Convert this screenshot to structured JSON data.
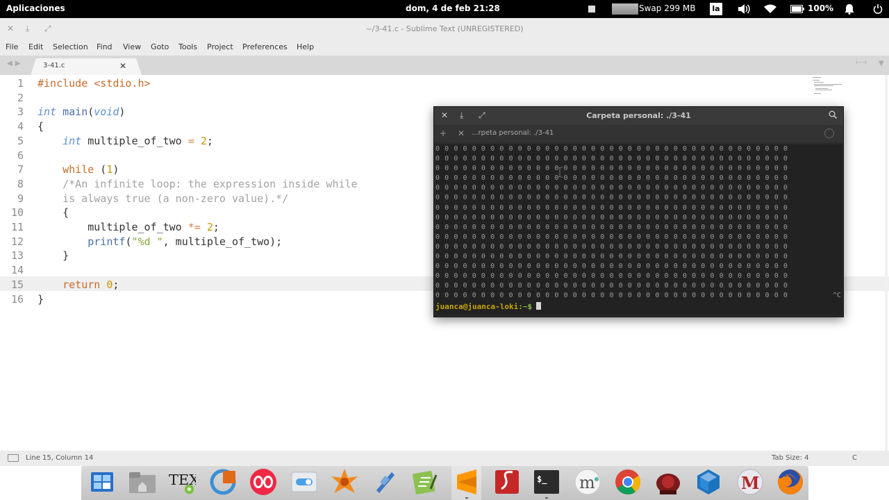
{
  "top_panel": {
    "apps_label": "Aplicaciones",
    "clock": "dom, 4 de feb  21:28",
    "swap": "Swap 299 MB",
    "keyboard_layout": "la",
    "battery": "100%",
    "icons": [
      "screen-icon",
      "volume-icon",
      "wifi-icon",
      "battery-icon",
      "notifications-icon",
      "power-icon"
    ]
  },
  "editor": {
    "window_title": "~/3-41.c - Sublime Text (UNREGISTERED)",
    "menu": [
      "File",
      "Edit",
      "Selection",
      "Find",
      "View",
      "Goto",
      "Tools",
      "Project",
      "Preferences",
      "Help"
    ],
    "tab_label": "3-41.c",
    "current_line": 15,
    "code_lines": [
      [
        [
          "k-pre",
          "#include "
        ],
        [
          "k-pre",
          "<stdio.h>"
        ]
      ],
      [],
      [
        [
          "k-type",
          "int"
        ],
        [
          "k-plain",
          " "
        ],
        [
          "k-fn",
          "main"
        ],
        [
          "k-plain",
          "("
        ],
        [
          "k-type",
          "void"
        ],
        [
          "k-plain",
          ")"
        ]
      ],
      [
        [
          "k-plain",
          "{"
        ]
      ],
      [
        [
          "k-plain",
          "    "
        ],
        [
          "k-type",
          "int"
        ],
        [
          "k-plain",
          " multiple_of_two "
        ],
        [
          "k-op",
          "="
        ],
        [
          "k-plain",
          " "
        ],
        [
          "k-num",
          "2"
        ],
        [
          "k-plain",
          ";"
        ]
      ],
      [],
      [
        [
          "k-plain",
          "    "
        ],
        [
          "k-kw",
          "while"
        ],
        [
          "k-plain",
          " ("
        ],
        [
          "k-num",
          "1"
        ],
        [
          "k-plain",
          ")"
        ]
      ],
      [
        [
          "k-plain",
          "    "
        ],
        [
          "k-cmt",
          "/*An infinite loop: the expression inside while"
        ]
      ],
      [
        [
          "k-plain",
          "    "
        ],
        [
          "k-cmt",
          "is always true (a non-zero value).*/"
        ]
      ],
      [
        [
          "k-plain",
          "    {"
        ]
      ],
      [
        [
          "k-plain",
          "        multiple_of_two "
        ],
        [
          "k-op",
          "*="
        ],
        [
          "k-plain",
          " "
        ],
        [
          "k-num",
          "2"
        ],
        [
          "k-plain",
          ";"
        ]
      ],
      [
        [
          "k-plain",
          "        "
        ],
        [
          "k-fn",
          "printf"
        ],
        [
          "k-plain",
          "("
        ],
        [
          "k-str",
          "\"%d \""
        ],
        [
          "k-plain",
          ", multiple_of_two);"
        ]
      ],
      [
        [
          "k-plain",
          "    }"
        ]
      ],
      [],
      [
        [
          "k-plain",
          "    "
        ],
        [
          "k-kw",
          "return"
        ],
        [
          "k-plain",
          " "
        ],
        [
          "k-num",
          "0"
        ],
        [
          "k-plain",
          ";"
        ]
      ],
      [
        [
          "k-plain",
          "}"
        ]
      ]
    ],
    "status_left": "Line 15, Column 14",
    "status_tab_size": "Tab Size: 4",
    "status_syntax": "C"
  },
  "terminal": {
    "title": "Carpeta personal: ./3-41",
    "tab_label": "...rpeta personal: ./3-41",
    "output_value": "0",
    "output_rows": 16,
    "output_cols": 39,
    "interrupt": "^C",
    "prompt_user": "juanca@juanca-loki",
    "prompt_path": ":~$"
  },
  "dock": {
    "apps": [
      "multitasking-view",
      "files",
      "texstudio",
      "ubuntu-software",
      "opera",
      "system-settings",
      "synaptic",
      "wavemon",
      "text-editor",
      "sublime-text",
      "scribus",
      "terminal",
      "mu-editor",
      "chrome",
      "frozen-bubble",
      "virtualbox",
      "maxima",
      "firefox"
    ],
    "active": "terminal",
    "terminal_label": "$_",
    "tex_label": "TEX"
  }
}
